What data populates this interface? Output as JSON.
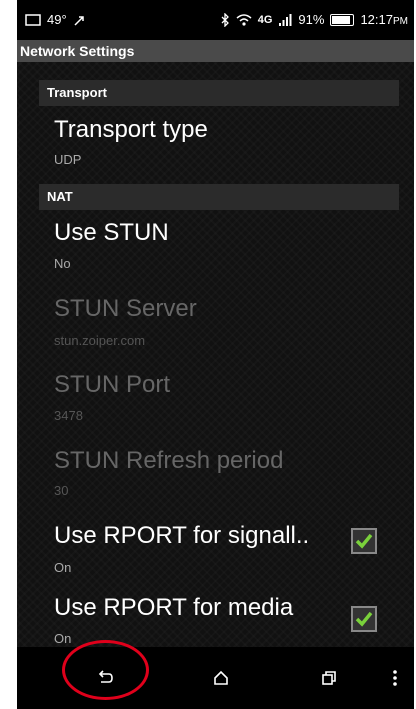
{
  "status_bar": {
    "temperature": "49°",
    "network_type": "4G",
    "battery_percent": "91%",
    "time": "12:17",
    "ampm": "PM",
    "icons": [
      "message-icon",
      "notification-icon",
      "bluetooth-icon",
      "wifi-icon",
      "signal-icon",
      "battery-icon"
    ]
  },
  "title": "Network Settings",
  "sections": {
    "transport": {
      "header": "Transport",
      "items": [
        {
          "title": "Transport type",
          "value": "UDP"
        }
      ]
    },
    "nat": {
      "header": "NAT",
      "items": [
        {
          "title": "Use STUN",
          "value": "No"
        },
        {
          "title": "STUN Server",
          "value": "stun.zoiper.com"
        },
        {
          "title": "STUN Port",
          "value": "3478"
        },
        {
          "title": "STUN Refresh period",
          "value": "30"
        },
        {
          "title": "Use RPORT for signall..",
          "value": "On",
          "checked": true
        },
        {
          "title": "Use RPORT for media",
          "value": "On",
          "checked": true
        }
      ]
    }
  },
  "navbar": {
    "icons": [
      "back-icon",
      "home-icon",
      "recent-apps-icon",
      "menu-icon"
    ]
  },
  "colors": {
    "accent_check": "#7ad13b",
    "highlight": "#e0001b"
  }
}
